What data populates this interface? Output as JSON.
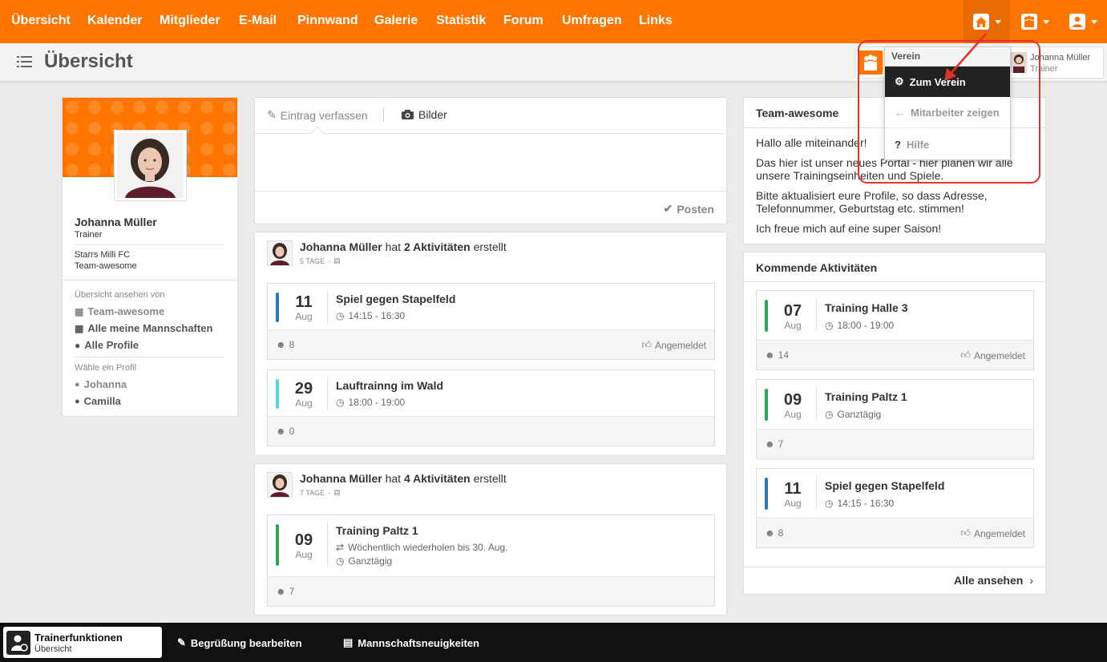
{
  "nav": {
    "items": [
      "Übersicht",
      "Kalender",
      "Mitglieder",
      "E-Mail",
      "Pinnwand",
      "Galerie",
      "Statistik",
      "Forum",
      "Umfragen",
      "Links"
    ],
    "icons": [
      "home-icon",
      "team-icon",
      "user-icon"
    ]
  },
  "page": {
    "title": "Übersicht"
  },
  "profile": {
    "name": "Johanna Müller",
    "role": "Trainer",
    "club": "Starrs Milli FC",
    "team": "Team-awesome",
    "view_label": "Übersicht ansehen von",
    "view_links": [
      "Team-awesome",
      "Alle meine Mannschaften",
      "Alle Profile"
    ],
    "choose_label": "Wähle ein Profil",
    "profiles": [
      "Johanna",
      "Camilla"
    ]
  },
  "composer": {
    "tab_write": "Eintrag verfassen",
    "tab_images": "Bilder",
    "post_label": "Posten"
  },
  "feed": [
    {
      "author": "Johanna Müller",
      "verb": "hat",
      "count_text": "2 Aktivitäten",
      "suffix": "erstellt",
      "age": "5 TAGE",
      "activities": [
        {
          "day": "11",
          "month": "Aug",
          "title": "Spiel gegen Stapelfeld",
          "time": "14:15 - 16:30",
          "participants": "8",
          "status": "Angemeldet",
          "color": "#2a7ab8"
        },
        {
          "day": "29",
          "month": "Aug",
          "title": "Lauftrainng im Wald",
          "time": "18:00 - 19:00",
          "participants": "0",
          "status": "",
          "color": "#4fd8e6"
        }
      ]
    },
    {
      "author": "Johanna Müller",
      "verb": "hat",
      "count_text": "4 Aktivitäten",
      "suffix": "erstellt",
      "age": "7 TAGE",
      "activities": [
        {
          "day": "09",
          "month": "Aug",
          "title": "Training Paltz 1",
          "repeat": "Wöchentlich wiederholen bis 30. Aug.",
          "time": "Ganztägig",
          "participants": "7",
          "status": "",
          "color": "#2ea84f"
        }
      ]
    }
  ],
  "team_card": {
    "title": "Team-awesome",
    "paragraphs": [
      "Hallo alle miteinander!",
      "Das hier ist unser neues Portal - hier planen wir alle unsere Trainingseinheiten und Spiele.",
      "Bitte aktualisiert eure Profile, so dass Adresse, Telefonnummer, Geburtstag etc. stimmen!",
      "Ich freue mich auf eine super Saison!"
    ]
  },
  "upcoming": {
    "title": "Kommende Aktivitäten",
    "items": [
      {
        "day": "07",
        "month": "Aug",
        "title": "Training Halle 3",
        "time": "18:00 - 19:00",
        "participants": "14",
        "status": "Angemeldet",
        "color": "#2ea84f"
      },
      {
        "day": "09",
        "month": "Aug",
        "title": "Training Paltz 1",
        "time": "Ganztägig",
        "participants": "7",
        "status": "",
        "color": "#2ea84f"
      },
      {
        "day": "11",
        "month": "Aug",
        "title": "Spiel gegen Stapelfeld",
        "time": "14:15 - 16:30",
        "participants": "8",
        "status": "Angemeldet",
        "color": "#2a7ab8"
      }
    ],
    "see_all": "Alle ansehen"
  },
  "switcher": {
    "club_label": "Verein",
    "user_name": "Johanna Müller",
    "user_role": "Trainer"
  },
  "dropdown": {
    "items": [
      "Zum Verein",
      "Mitarbeiter zeigen",
      "Hilfe"
    ]
  },
  "bottom": {
    "title": "Trainerfunktionen",
    "subtitle": "Übersicht",
    "actions": [
      "Begrüßung bearbeiten",
      "Mannschaftsneuigkeiten"
    ]
  },
  "colors": {
    "accent": "#ff7500",
    "annotation": "#e4322b"
  }
}
